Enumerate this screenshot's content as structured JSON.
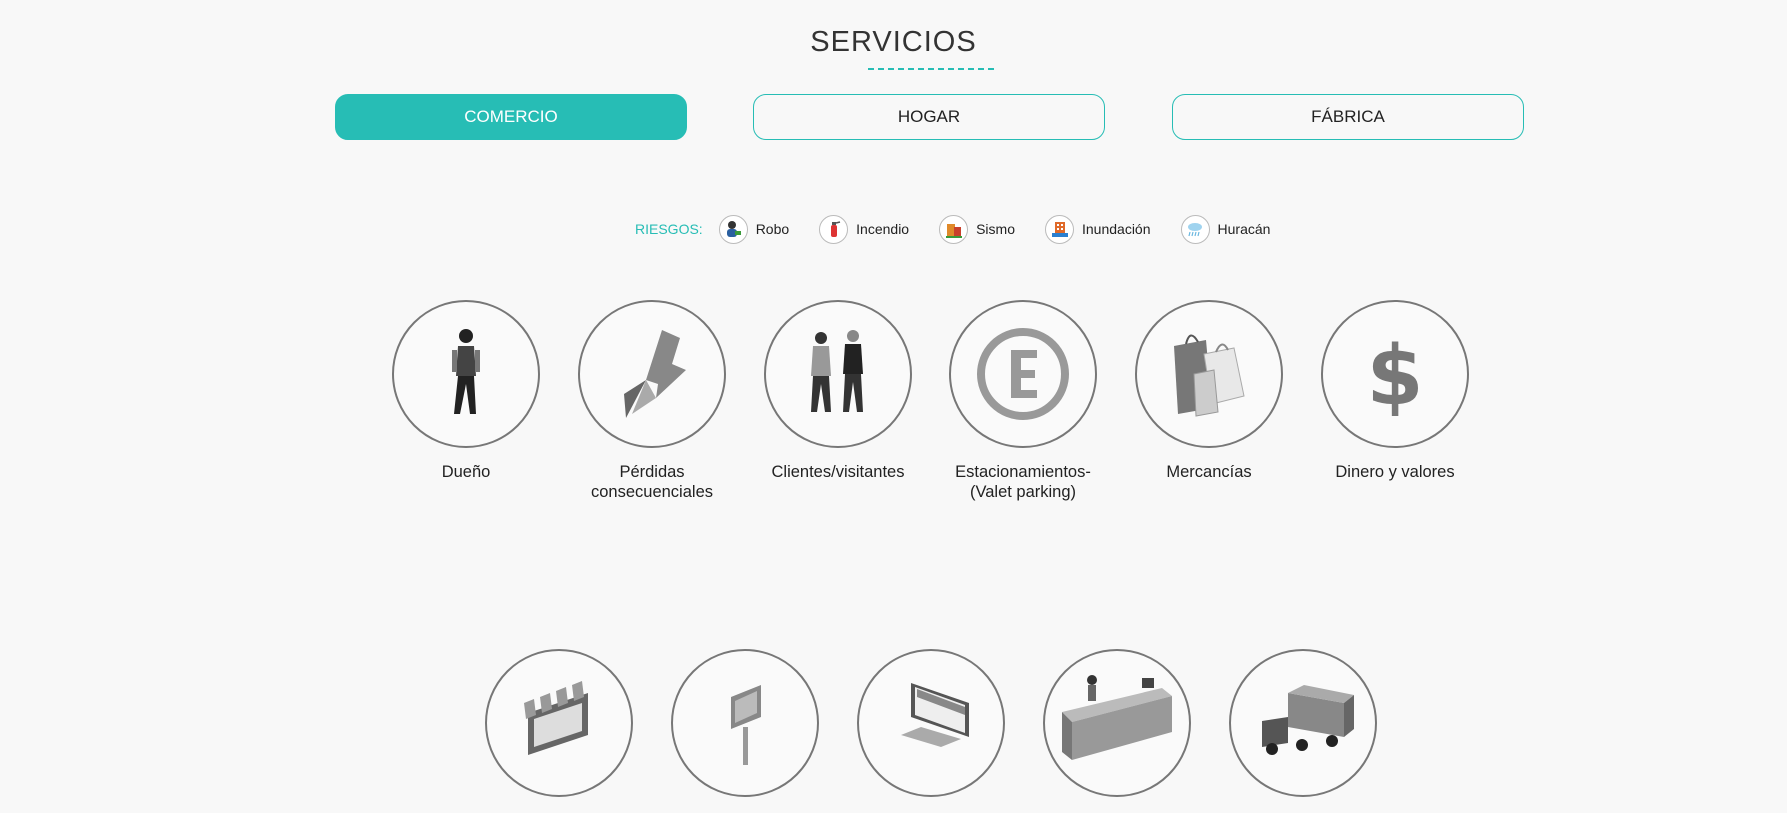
{
  "header": {
    "title": "SERVICIOS"
  },
  "tabs": [
    {
      "label": "COMERCIO",
      "active": true
    },
    {
      "label": "HOGAR",
      "active": false
    },
    {
      "label": "FÁBRICA",
      "active": false
    }
  ],
  "risks": {
    "label": "RIESGOS:",
    "items": [
      {
        "label": "Robo",
        "icon": "thief-icon"
      },
      {
        "label": "Incendio",
        "icon": "fire-extinguisher-icon"
      },
      {
        "label": "Sismo",
        "icon": "earthquake-icon"
      },
      {
        "label": "Inundación",
        "icon": "flood-icon"
      },
      {
        "label": "Huracán",
        "icon": "hurricane-icon"
      }
    ]
  },
  "services_row1": [
    {
      "label": "Dueño",
      "icon": "owner-icon"
    },
    {
      "label": "Pérdidas\nconsecuenciales",
      "icon": "lightning-arrow-icon"
    },
    {
      "label": "Clientes/visitantes",
      "icon": "visitors-icon"
    },
    {
      "label": "Estacionamientos-\n(Valet parking)",
      "icon": "parking-icon"
    },
    {
      "label": "Mercancías",
      "icon": "shopping-bags-icon"
    },
    {
      "label": "Dinero y valores",
      "icon": "dollar-icon"
    }
  ],
  "services_row2": [
    {
      "icon": "storefront-icon"
    },
    {
      "icon": "signpost-icon"
    },
    {
      "icon": "online-store-icon"
    },
    {
      "icon": "reception-desk-icon"
    },
    {
      "icon": "truck-icon"
    }
  ],
  "colors": {
    "accent": "#27bdb5",
    "circle_border": "#777777",
    "background": "#f8f8f8"
  }
}
